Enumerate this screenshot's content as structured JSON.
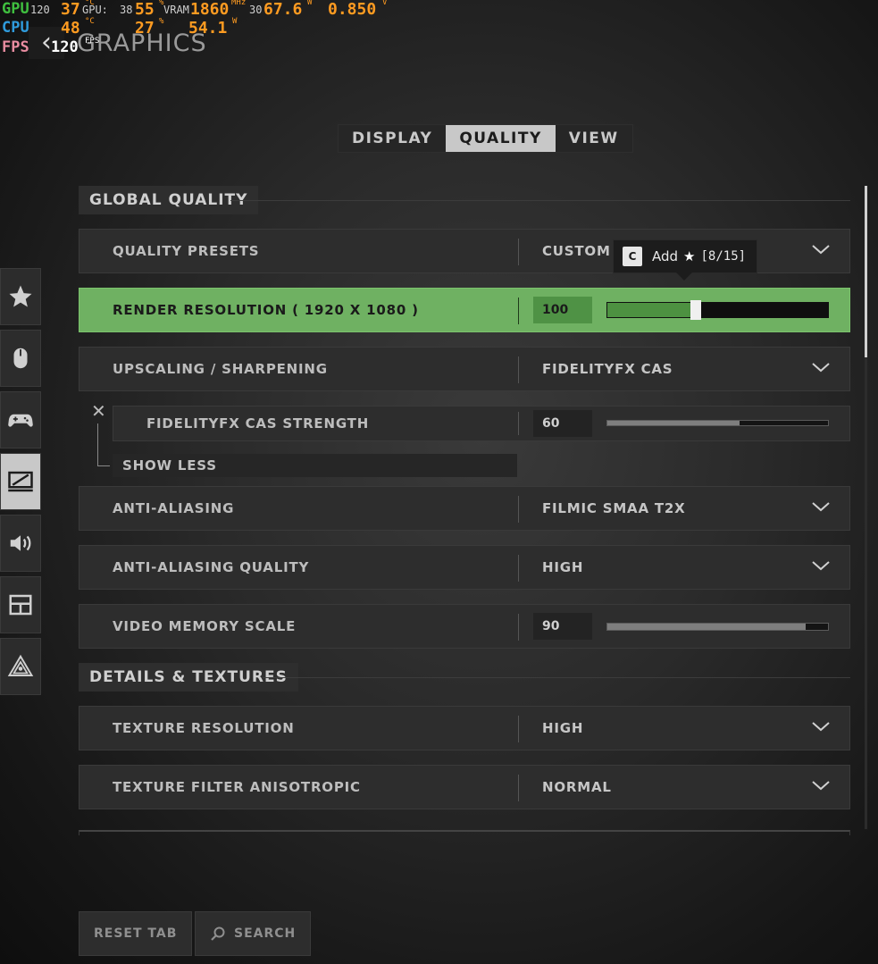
{
  "hud": {
    "gpu": {
      "label": "GPU",
      "temp": "37",
      "temp_unit": "°C",
      "usage_label": "GPU:",
      "usage_prefix": "38",
      "usage": "55",
      "usage_unit": "%",
      "vram_label": "VRAM",
      "clock": "1860",
      "clock_unit": "MHz",
      "mem_prefix": "30",
      "power": "67.6",
      "power_unit": "W",
      "voltage": "0.850",
      "voltage_unit": "V",
      "left_val": "120"
    },
    "cpu": {
      "label": "CPU",
      "temp": "48",
      "temp_unit": "°C",
      "usage": "27",
      "usage_unit": "%",
      "power": "54.1",
      "power_unit": "W"
    },
    "fps": {
      "label": "FPS",
      "value": "120",
      "unit": "FPS"
    }
  },
  "page_title": "GRAPHICS",
  "tabs": [
    {
      "label": "DISPLAY"
    },
    {
      "label": "QUALITY"
    },
    {
      "label": "VIEW"
    }
  ],
  "sidebar_icons": [
    "star-icon",
    "mouse-icon",
    "gamepad-icon",
    "display-icon",
    "speaker-icon",
    "layout-icon",
    "network-icon"
  ],
  "sections": {
    "global": "GLOBAL QUALITY",
    "details": "DETAILS & TEXTURES"
  },
  "settings": {
    "quality_presets": {
      "name": "QUALITY PRESETS",
      "value": "CUSTOM"
    },
    "render_resolution": {
      "name": "RENDER RESOLUTION ( 1920 X 1080 )",
      "value": "100",
      "level": 0.4
    },
    "upscaling": {
      "name": "UPSCALING / SHARPENING",
      "value": "FIDELITYFX CAS"
    },
    "cas_strength": {
      "name": "FIDELITYFX CAS STRENGTH",
      "value": "60",
      "level": 0.6
    },
    "show_less": "SHOW LESS",
    "anti_aliasing": {
      "name": "ANTI-ALIASING",
      "value": "FILMIC SMAA T2X"
    },
    "aa_quality": {
      "name": "ANTI-ALIASING QUALITY",
      "value": "HIGH"
    },
    "video_memory": {
      "name": "VIDEO MEMORY SCALE",
      "value": "90",
      "level": 0.9
    },
    "texture_resolution": {
      "name": "TEXTURE RESOLUTION",
      "value": "HIGH"
    },
    "texture_filter": {
      "name": "TEXTURE FILTER ANISOTROPIC",
      "value": "NORMAL"
    }
  },
  "tooltip": {
    "key": "C",
    "text": "Add",
    "count": "[8/15]"
  },
  "footer": {
    "reset": "RESET TAB",
    "search": "SEARCH"
  },
  "colors": {
    "highlight": "#6fb162",
    "hud_orange": "#ff9b21",
    "hud_gpu": "#3fbf3f",
    "hud_cpu": "#2f9bdc",
    "hud_fps": "#e88ca0"
  }
}
